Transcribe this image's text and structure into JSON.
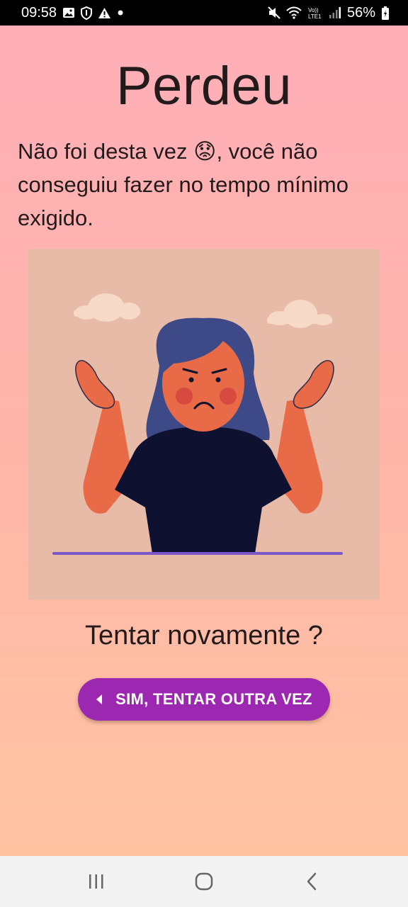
{
  "status_bar": {
    "time": "09:58",
    "battery": "56%",
    "icons_left": [
      "gallery-icon",
      "shield-icon",
      "warning-icon",
      "dot-icon"
    ],
    "icons_right": [
      "mute-icon",
      "wifi-icon",
      "volte-icon",
      "signal-icon",
      "battery-icon"
    ],
    "volte_label": "Vo)) LTE1"
  },
  "screen": {
    "title": "Perdeu",
    "message": "Não foi desta vez 😟, você não conseguiu fazer no tempo mínimo exigido.",
    "retry_question": "Tentar novamente ?",
    "retry_button_label": "SIM, TENTAR OUTRA VEZ"
  },
  "colors": {
    "gradient_top": "#ffaeb8",
    "gradient_bottom": "#ffc3a2",
    "button": "#9c27b0",
    "illustration_bg": "#e8bba9"
  },
  "nav_bar": {
    "buttons": [
      "recent-apps-icon",
      "home-icon",
      "back-icon"
    ]
  }
}
